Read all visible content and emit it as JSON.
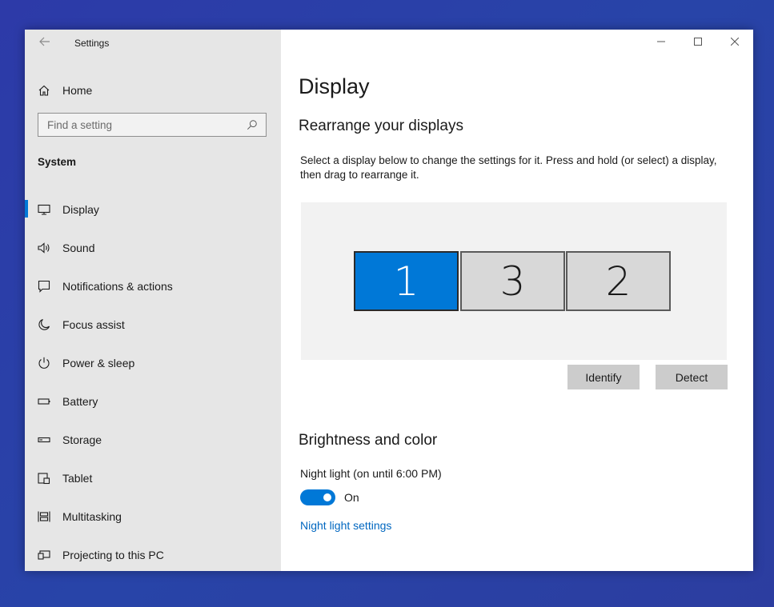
{
  "app": {
    "title": "Settings"
  },
  "sidebar": {
    "home_label": "Home",
    "search_placeholder": "Find a setting",
    "section_label": "System",
    "items": [
      {
        "label": "Display",
        "icon": "monitor-icon",
        "active": true
      },
      {
        "label": "Sound",
        "icon": "speaker-icon"
      },
      {
        "label": "Notifications & actions",
        "icon": "message-icon"
      },
      {
        "label": "Focus assist",
        "icon": "moon-icon"
      },
      {
        "label": "Power & sleep",
        "icon": "power-icon"
      },
      {
        "label": "Battery",
        "icon": "battery-icon"
      },
      {
        "label": "Storage",
        "icon": "storage-icon"
      },
      {
        "label": "Tablet",
        "icon": "tablet-icon"
      },
      {
        "label": "Multitasking",
        "icon": "multitasking-icon"
      },
      {
        "label": "Projecting to this PC",
        "icon": "projecting-icon"
      }
    ]
  },
  "main": {
    "title": "Display",
    "rearrange": {
      "heading": "Rearrange your displays",
      "description": "Select a display below to change the settings for it. Press and hold (or select) a display, then drag to rearrange it.",
      "displays": [
        "1",
        "3",
        "2"
      ],
      "selected_display": "1",
      "identify_label": "Identify",
      "detect_label": "Detect"
    },
    "brightness": {
      "heading": "Brightness and color",
      "night_light_label": "Night light (on until 6:00 PM)",
      "toggle_state": "On",
      "night_light_link": "Night light settings"
    }
  },
  "colors": {
    "accent": "#0078d7",
    "sidebar_bg": "#e6e6e6",
    "link": "#0067c0"
  }
}
